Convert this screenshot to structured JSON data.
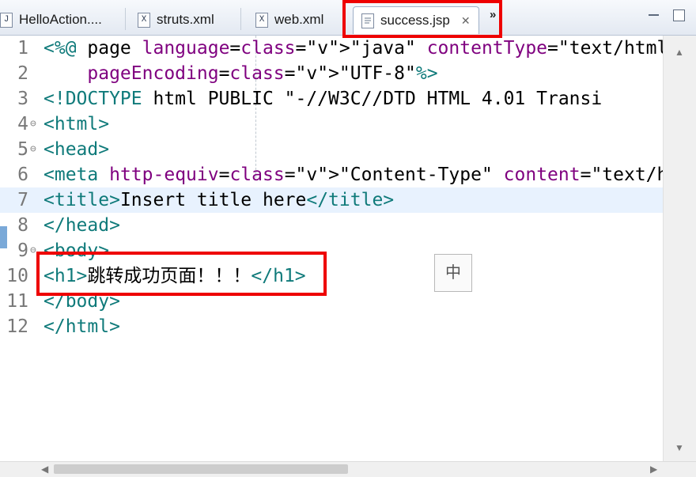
{
  "tabs": [
    {
      "label": "HelloAction....",
      "icon": "J"
    },
    {
      "label": "struts.xml",
      "icon": "X"
    },
    {
      "label": "web.xml",
      "icon": "X"
    },
    {
      "label": "success.jsp",
      "icon": "jsp-file-icon",
      "active": true
    }
  ],
  "overflow_label": "»",
  "ime_indicator": "中",
  "colors": {
    "highlight": "#ee0000",
    "tag": "#0f7a7a",
    "attr": "#7f007f",
    "value": "#2a00ff"
  },
  "editor": {
    "current_line": 7,
    "lines": [
      {
        "num": "1",
        "text": "<%@ page language=\"java\" contentType=\"text/html; ch"
      },
      {
        "num": "2",
        "text": "    pageEncoding=\"UTF-8\"%>"
      },
      {
        "num": "3",
        "text": "<!DOCTYPE html PUBLIC \"-//W3C//DTD HTML 4.01 Transi"
      },
      {
        "num": "4",
        "text": "<html>"
      },
      {
        "num": "5",
        "text": "<head>"
      },
      {
        "num": "6",
        "text": "<meta http-equiv=\"Content-Type\" content=\"text/html;"
      },
      {
        "num": "7",
        "text": "<title>Insert title here</title>"
      },
      {
        "num": "8",
        "text": "</head>"
      },
      {
        "num": "9",
        "text": "<body>"
      },
      {
        "num": "10",
        "text": "<h1>跳转成功页面！！！</h1>"
      },
      {
        "num": "11",
        "text": "</body>"
      },
      {
        "num": "12",
        "text": "</html>"
      }
    ]
  }
}
